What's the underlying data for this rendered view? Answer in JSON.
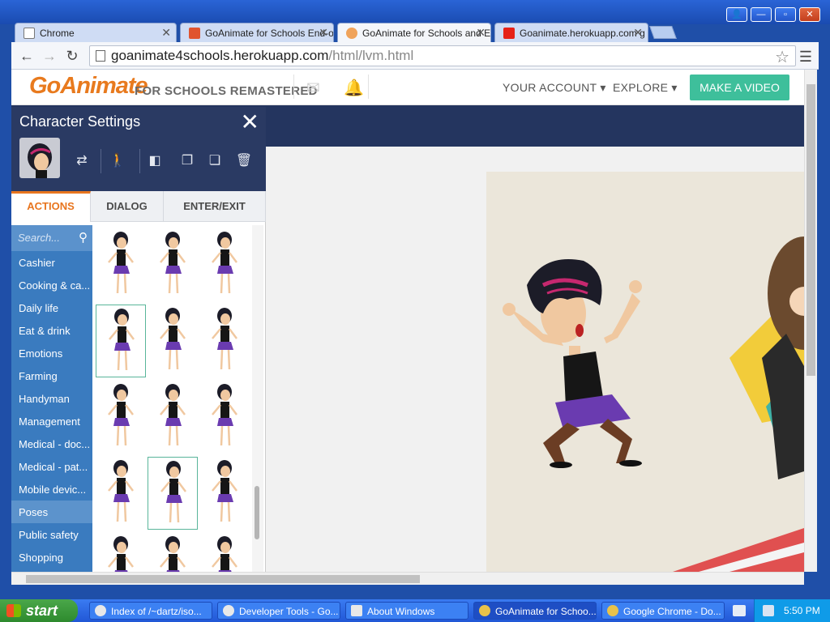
{
  "browser": {
    "tabs": [
      {
        "title": "Chrome",
        "icon": "page-icon",
        "active": false
      },
      {
        "title": "GoAnimate for Schools End-o",
        "icon": "vivaldi-icon",
        "active": false
      },
      {
        "title": "GoAnimate for Schools and E",
        "icon": "goanimate-icon",
        "active": true
      },
      {
        "title": "Goanimate.herokuapp.com g",
        "icon": "youtube-icon",
        "active": false
      }
    ],
    "url_host": "goanimate4schools.herokuapp.com",
    "url_path": "/html/lvm.html"
  },
  "site": {
    "logo": "GoAnimate",
    "logo_sub": "FOR SCHOOLS REMASTERED",
    "your_account": "YOUR ACCOUNT ▾",
    "explore": "EXPLORE ▾",
    "make_video": "MAKE A VIDEO"
  },
  "panel": {
    "title": "Character Settings",
    "tabs": [
      "ACTIONS",
      "DIALOG",
      "ENTER/EXIT"
    ],
    "active_tab": "ACTIONS",
    "search_placeholder": "Search...",
    "categories": [
      "Cashier",
      "Cooking & ca...",
      "Daily life",
      "Eat & drink",
      "Emotions",
      "Farming",
      "Handyman",
      "Management",
      "Medical - doc...",
      "Medical - pat...",
      "Mobile devic...",
      "Poses",
      "Public safety",
      "Shopping"
    ],
    "selected_category": "Poses"
  },
  "taskbar": {
    "start": "start",
    "tasks": [
      "Index of /~dartz/iso...",
      "Developer Tools - Go...",
      "About Windows",
      "GoAnimate for Schoo...",
      "Google Chrome - Do..."
    ],
    "active_task": "GoAnimate for Schoo...",
    "clock": "5:50 PM"
  },
  "colors": {
    "accent_orange": "#e8751e",
    "make_video_green": "#3ebf9b",
    "panel_navy": "#2a3a63",
    "category_blue": "#3a7bbf"
  }
}
